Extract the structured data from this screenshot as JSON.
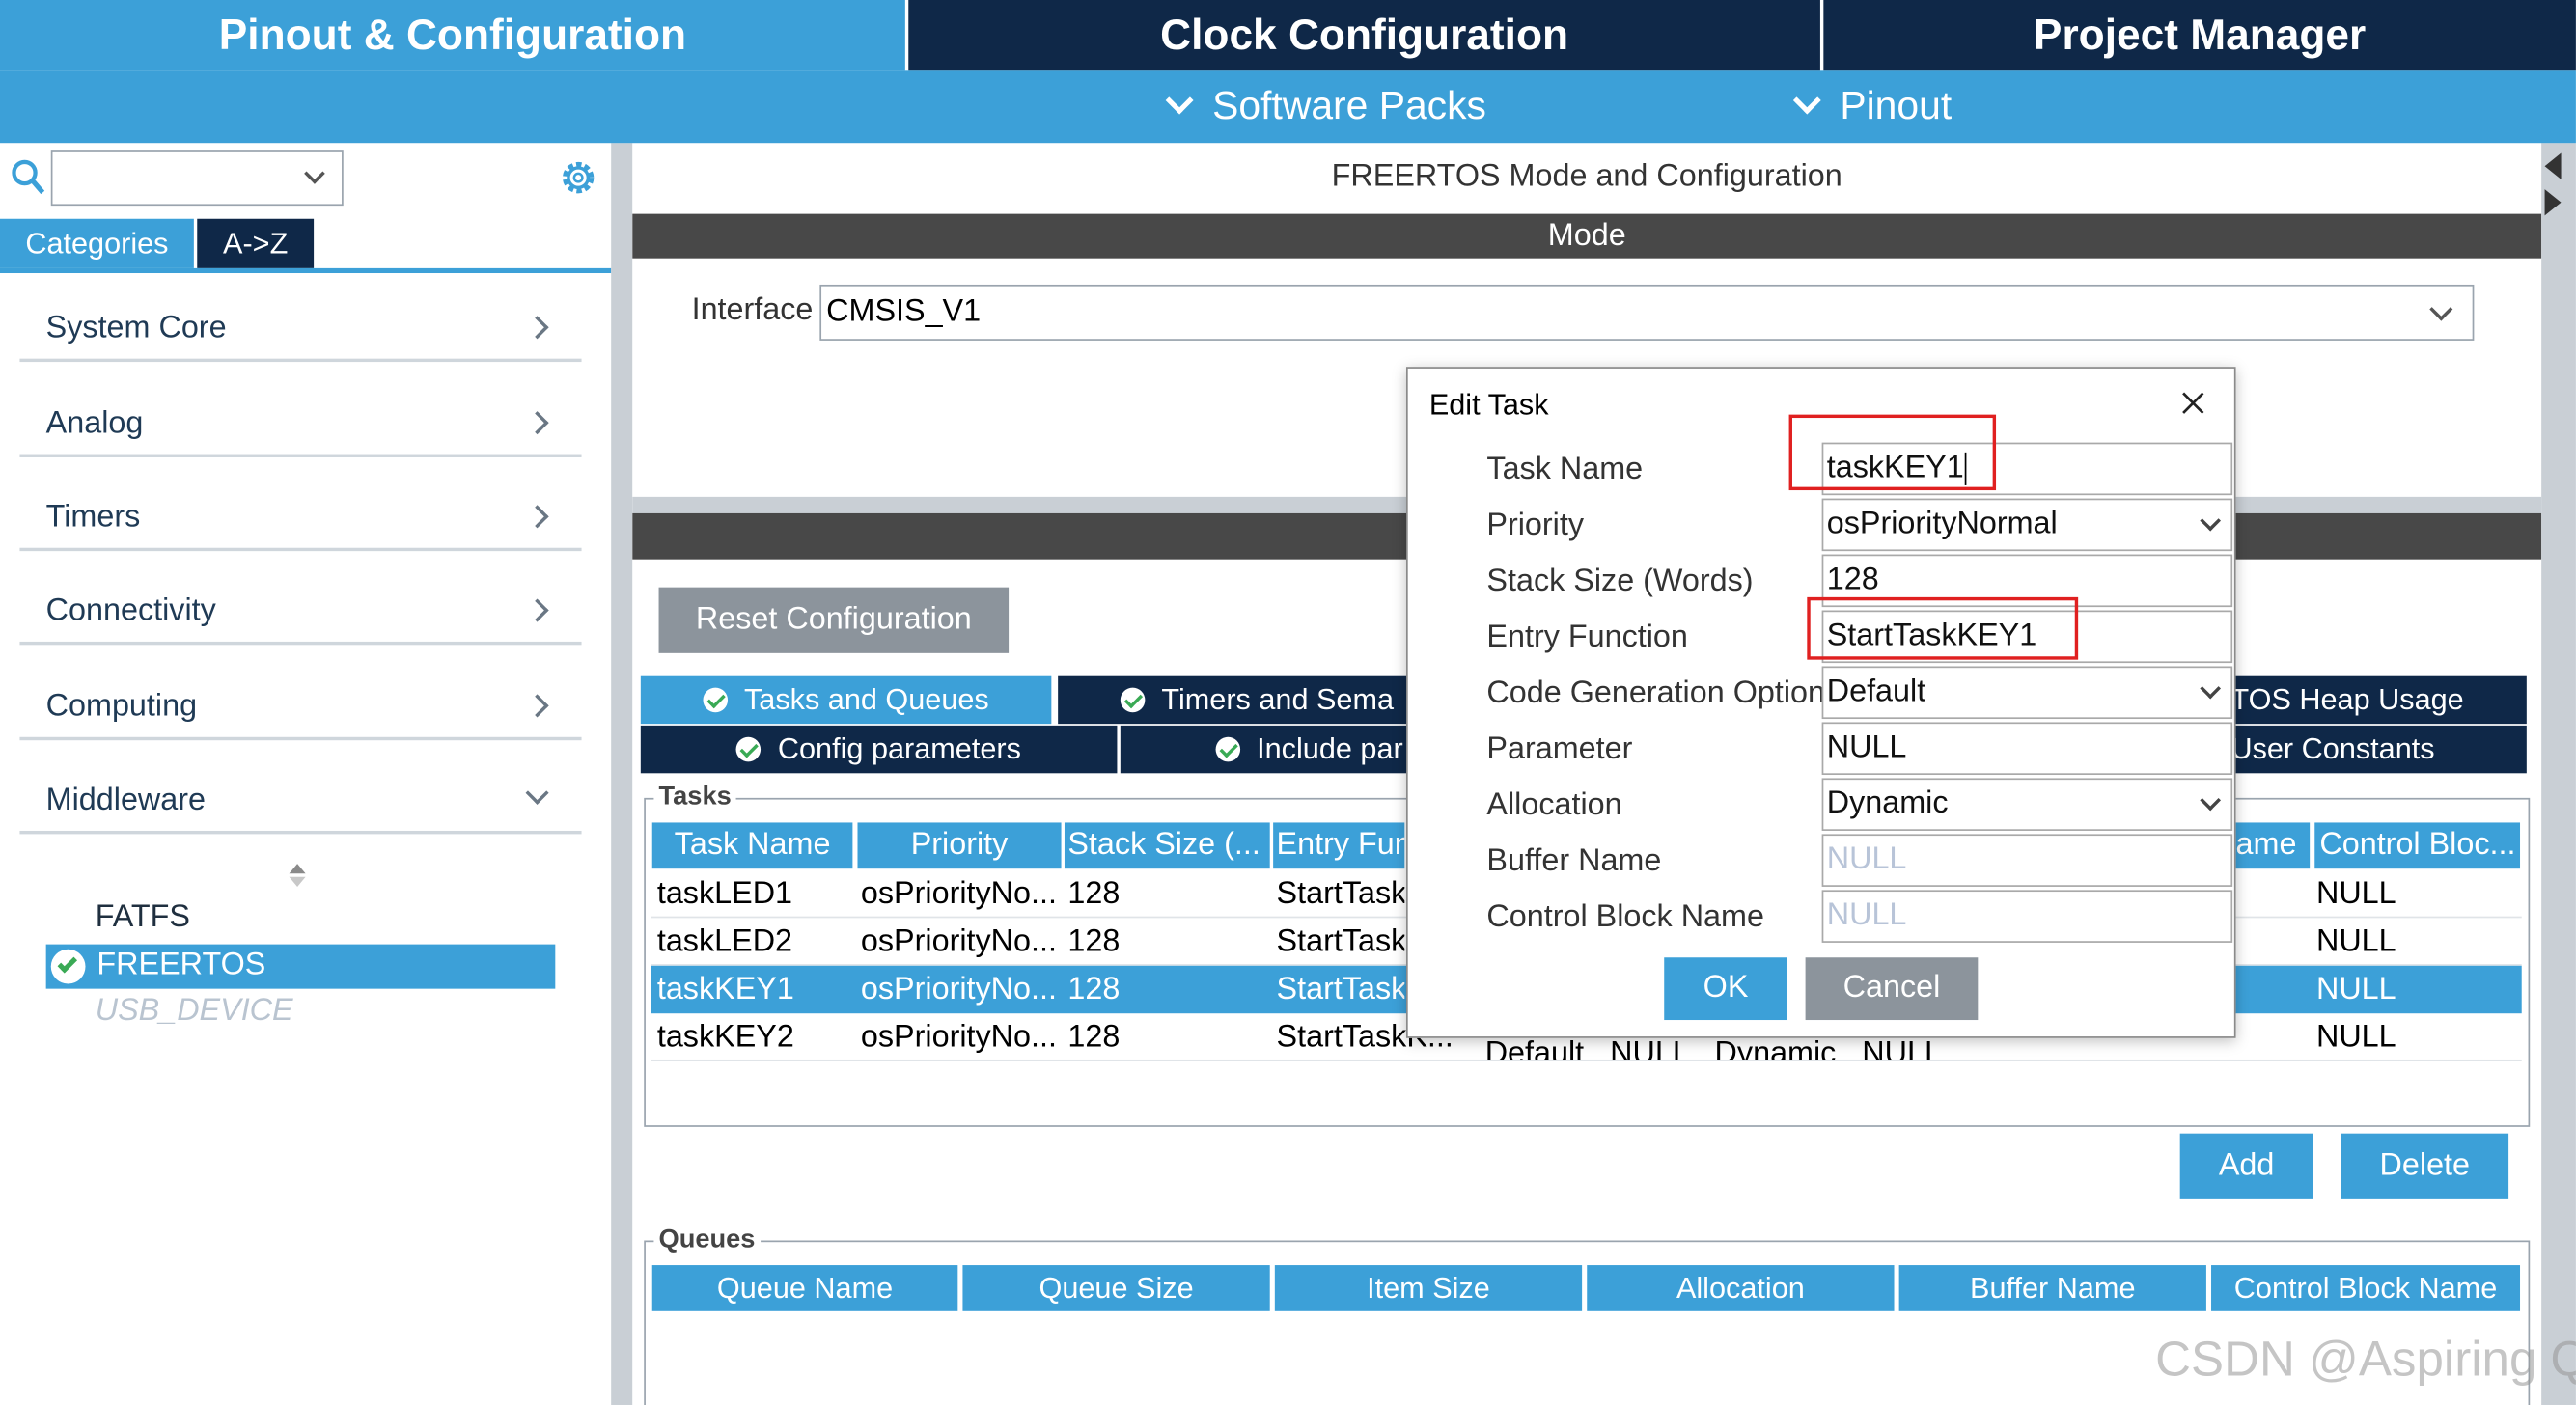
{
  "top_tabs": {
    "pinout_config": "Pinout & Configuration",
    "clock_config": "Clock Configuration",
    "project_manager": "Project Manager"
  },
  "sub_menu": {
    "software_packs": "Software Packs",
    "pinout": "Pinout"
  },
  "sidebar": {
    "search_value": "",
    "tab_categories": "Categories",
    "tab_az": "A->Z",
    "categories": [
      {
        "label": "System Core"
      },
      {
        "label": "Analog"
      },
      {
        "label": "Timers"
      },
      {
        "label": "Connectivity"
      },
      {
        "label": "Computing"
      },
      {
        "label": "Middleware"
      }
    ],
    "middleware_items": [
      {
        "label": "FATFS",
        "state": "normal"
      },
      {
        "label": "FREERTOS",
        "state": "selected"
      },
      {
        "label": "USB_DEVICE",
        "state": "disabled"
      }
    ]
  },
  "main": {
    "title": "FREERTOS Mode and Configuration",
    "mode_header": "Mode",
    "interface_label": "Interface",
    "interface_value": "CMSIS_V1",
    "reset_button": "Reset Configuration",
    "config_tabs_row1": [
      "Tasks and Queues",
      "Timers and Sema",
      "TOS Heap Usage"
    ],
    "config_tabs_row2": [
      "Config parameters",
      "Include par",
      "User Constants"
    ],
    "tasks_group": "Tasks",
    "tasks_columns": [
      "Task Name",
      "Priority",
      "Stack Size (...",
      "Entry Fun",
      "ame",
      "Control Bloc..."
    ],
    "tasks_rows": [
      {
        "name": "taskLED1",
        "priority": "osPriorityNo...",
        "stack": "128",
        "entry": "StartTask",
        "extra": "",
        "control": "NULL",
        "selected": false
      },
      {
        "name": "taskLED2",
        "priority": "osPriorityNo...",
        "stack": "128",
        "entry": "StartTask",
        "extra": "",
        "control": "NULL",
        "selected": false
      },
      {
        "name": "taskKEY1",
        "priority": "osPriorityNo...",
        "stack": "128",
        "entry": "StartTask",
        "extra": "",
        "control": "NULL",
        "selected": true
      },
      {
        "name": "taskKEY2",
        "priority": "osPriorityNo...",
        "stack": "128",
        "entry": "StartTaskK...",
        "extra": "Default   NULL   Dynamic   NULL",
        "control": "NULL",
        "selected": false
      }
    ],
    "add_button": "Add",
    "delete_button": "Delete",
    "queues_group": "Queues",
    "queues_columns": [
      "Queue Name",
      "Queue Size",
      "Item Size",
      "Allocation",
      "Buffer Name",
      "Control Block Name"
    ]
  },
  "dialog": {
    "title": "Edit Task",
    "fields": [
      {
        "label": "Task Name",
        "value": "taskKEY1"
      },
      {
        "label": "Priority",
        "value": "osPriorityNormal"
      },
      {
        "label": "Stack Size (Words)",
        "value": "128"
      },
      {
        "label": "Entry Function",
        "value": "StartTaskKEY1"
      },
      {
        "label": "Code Generation Option",
        "value": "Default"
      },
      {
        "label": "Parameter",
        "value": "NULL"
      },
      {
        "label": "Allocation",
        "value": "Dynamic"
      },
      {
        "label": "Buffer Name",
        "value": "NULL"
      },
      {
        "label": "Control Block Name",
        "value": "NULL"
      }
    ],
    "ok_button": "OK",
    "cancel_button": "Cancel"
  },
  "watermark": "CSDN @Aspiring Q",
  "colors": {
    "accent_blue": "#3ca0d8",
    "dark_navy": "#0f2848",
    "highlight_red": "#e02020"
  }
}
